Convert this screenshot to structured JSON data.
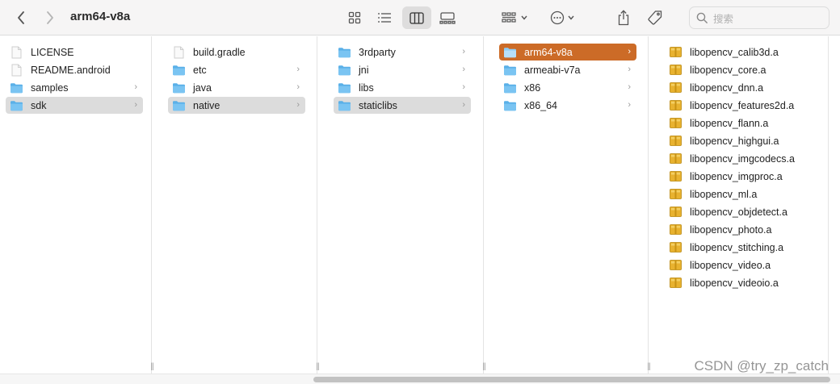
{
  "window": {
    "title": "arm64-v8a"
  },
  "search": {
    "placeholder": "搜索"
  },
  "colors": {
    "accent": "#cc6b27",
    "folder": "#5ab0e8",
    "selection_gray": "#dcdcdc"
  },
  "columns": [
    {
      "items": [
        {
          "label": "LICENSE",
          "icon": "file-icon",
          "chevron": false,
          "selected": "none"
        },
        {
          "label": "README.android",
          "icon": "file-icon",
          "chevron": false,
          "selected": "none"
        },
        {
          "label": "samples",
          "icon": "folder-icon",
          "chevron": true,
          "selected": "none"
        },
        {
          "label": "sdk",
          "icon": "folder-icon",
          "chevron": true,
          "selected": "gray"
        }
      ]
    },
    {
      "items": [
        {
          "label": "build.gradle",
          "icon": "file-icon",
          "chevron": false,
          "selected": "none"
        },
        {
          "label": "etc",
          "icon": "folder-icon",
          "chevron": true,
          "selected": "none"
        },
        {
          "label": "java",
          "icon": "folder-icon",
          "chevron": true,
          "selected": "none"
        },
        {
          "label": "native",
          "icon": "folder-icon",
          "chevron": true,
          "selected": "gray"
        }
      ]
    },
    {
      "items": [
        {
          "label": "3rdparty",
          "icon": "folder-icon",
          "chevron": true,
          "selected": "none"
        },
        {
          "label": "jni",
          "icon": "folder-icon",
          "chevron": true,
          "selected": "none"
        },
        {
          "label": "libs",
          "icon": "folder-icon",
          "chevron": true,
          "selected": "none"
        },
        {
          "label": "staticlibs",
          "icon": "folder-icon",
          "chevron": true,
          "selected": "gray"
        }
      ]
    },
    {
      "items": [
        {
          "label": "arm64-v8a",
          "icon": "folder-icon",
          "chevron": true,
          "selected": "accent"
        },
        {
          "label": "armeabi-v7a",
          "icon": "folder-icon",
          "chevron": true,
          "selected": "none"
        },
        {
          "label": "x86",
          "icon": "folder-icon",
          "chevron": true,
          "selected": "none"
        },
        {
          "label": "x86_64",
          "icon": "folder-icon",
          "chevron": true,
          "selected": "none"
        }
      ]
    },
    {
      "items": [
        {
          "label": "libopencv_calib3d.a",
          "icon": "archive-icon",
          "chevron": false,
          "selected": "none"
        },
        {
          "label": "libopencv_core.a",
          "icon": "archive-icon",
          "chevron": false,
          "selected": "none"
        },
        {
          "label": "libopencv_dnn.a",
          "icon": "archive-icon",
          "chevron": false,
          "selected": "none"
        },
        {
          "label": "libopencv_features2d.a",
          "icon": "archive-icon",
          "chevron": false,
          "selected": "none"
        },
        {
          "label": "libopencv_flann.a",
          "icon": "archive-icon",
          "chevron": false,
          "selected": "none"
        },
        {
          "label": "libopencv_highgui.a",
          "icon": "archive-icon",
          "chevron": false,
          "selected": "none"
        },
        {
          "label": "libopencv_imgcodecs.a",
          "icon": "archive-icon",
          "chevron": false,
          "selected": "none"
        },
        {
          "label": "libopencv_imgproc.a",
          "icon": "archive-icon",
          "chevron": false,
          "selected": "none"
        },
        {
          "label": "libopencv_ml.a",
          "icon": "archive-icon",
          "chevron": false,
          "selected": "none"
        },
        {
          "label": "libopencv_objdetect.a",
          "icon": "archive-icon",
          "chevron": false,
          "selected": "none"
        },
        {
          "label": "libopencv_photo.a",
          "icon": "archive-icon",
          "chevron": false,
          "selected": "none"
        },
        {
          "label": "libopencv_stitching.a",
          "icon": "archive-icon",
          "chevron": false,
          "selected": "none"
        },
        {
          "label": "libopencv_video.a",
          "icon": "archive-icon",
          "chevron": false,
          "selected": "none"
        },
        {
          "label": "libopencv_videoio.a",
          "icon": "archive-icon",
          "chevron": false,
          "selected": "none"
        }
      ]
    }
  ],
  "watermark": "CSDN @try_zp_catch"
}
